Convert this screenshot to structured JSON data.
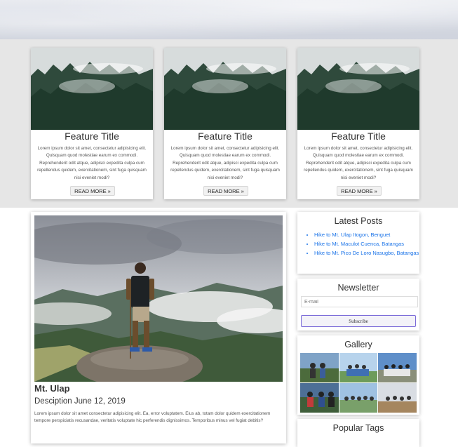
{
  "features": [
    {
      "title": "Feature Title",
      "text": "Lorem ipsum dolor sit amet, consectetur adipisicing elit. Quisquam quod molestiae earum ex commodi. Reprehenderit odit atque, adipisci expedita culpa cum repellendus quidem, exercitationem, sint fuga quisquam nisi eveniet modi?",
      "button": "READ MORE »"
    },
    {
      "title": "Feature Title",
      "text": "Lorem ipsum dolor sit amet, consectetur adipisicing elit. Quisquam quod molestiae earum ex commodi. Reprehenderit odit atque, adipisci expedita culpa cum repellendus quidem, exercitationem, sint fuga quisquam nisi eveniet modi?",
      "button": "READ MORE »"
    },
    {
      "title": "Feature Title",
      "text": "Lorem ipsum dolor sit amet, consectetur adipisicing elit. Quisquam quod molestiae earum ex commodi. Reprehenderit odit atque, adipisci expedita culpa cum repellendus quidem, exercitationem, sint fuga quisquam nisi eveniet modi?",
      "button": "READ MORE »"
    }
  ],
  "post": {
    "title": "Mt. Ulap",
    "description": "Desciption June 12, 2019",
    "text": "Lorem ipsum dolor sit amet consectetur adipisicing elit. Ea, error voluptatem. Eius ab, totam dolor quidem exercitationem tempore perspiciatis recusandae, veritatis voluptate hic perferendis dignissimos. Temporibus minus vel fugiat debitis?"
  },
  "sidebar": {
    "latest": {
      "title": "Latest Posts",
      "items": [
        "Hike to Mt. Ulap Itogon, Benguet",
        "Hike to Mt. Maculot Cuenca, Batangas",
        "Hike to Mt. Pico De Loro Nasugbo, Batangas"
      ]
    },
    "newsletter": {
      "title": "Newsletter",
      "placeholder": "E-mail",
      "button": "Subscribe"
    },
    "gallery": {
      "title": "Gallery"
    },
    "tags": {
      "title": "Popular Tags"
    }
  },
  "colors": {
    "link": "#1a73e8",
    "button_border": "#7a6ad8",
    "section_bg": "#e6e6e6"
  }
}
